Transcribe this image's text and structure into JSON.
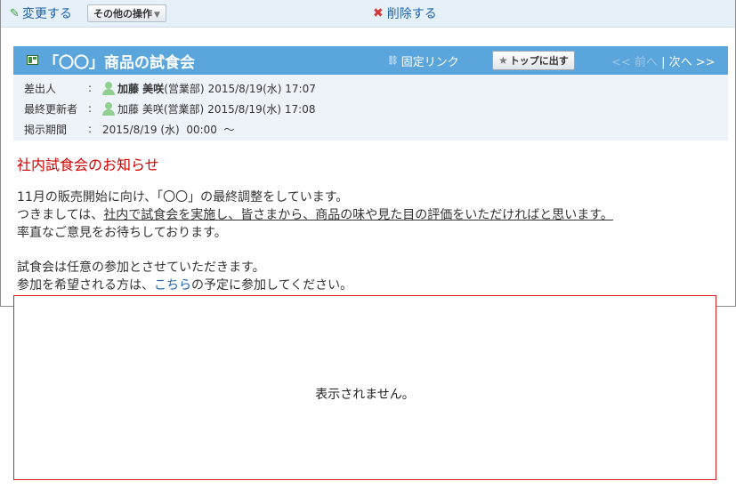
{
  "toolbar": {
    "edit_label": "変更する",
    "more_label": "その他の操作",
    "delete_label": "削除する"
  },
  "header": {
    "title": "「〇〇」商品の試食会",
    "permalink_label": "固定リンク",
    "top_button_label": "トップに出す",
    "prev_label": "<< 前へ",
    "separator": "|",
    "next_label": "次へ >>"
  },
  "meta": {
    "sender": {
      "label": "差出人",
      "colon": ":",
      "name": "加藤 美咲",
      "dept": "(営業部)",
      "datetime": "2015/8/19(水) 17:07"
    },
    "updater": {
      "label": "最終更新者",
      "colon": ":",
      "name": "加藤 美咲",
      "dept": "(営業部)",
      "datetime": "2015/8/19(水) 17:08"
    },
    "period": {
      "label": "掲示期間",
      "colon": ":",
      "value": "2015/8/19 (水)  00:00  ～"
    }
  },
  "body": {
    "heading": "社内試食会のお知らせ",
    "line1": "11月の販売開始に向け、「〇〇」の最終調整をしています。",
    "line2_pre": "つきましては、",
    "line2_underlined": "社内で試食会を実施し、皆さまから、商品の味や見た目の評価をいただければと思います。",
    "line3": "率直なご意見をお待ちしております。",
    "line4": "試食会は任意の参加とさせていただきます。",
    "line5_pre": "参加を希望される方は、",
    "line5_link": "こちら",
    "line5_post": "の予定に参加してください。"
  },
  "hidden_area": {
    "message": "表示されません。"
  },
  "colors": {
    "title_bar": "#5aa6dc",
    "heading": "#cc0000",
    "link": "#1f62a8",
    "highlight_box": "#e02020"
  }
}
